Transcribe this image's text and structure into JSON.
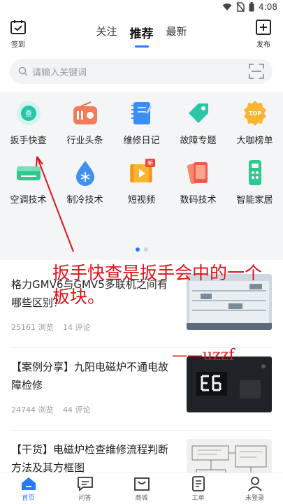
{
  "status_bar": {
    "time": "4:08"
  },
  "header": {
    "checkin_label": "签到",
    "post_label": "发布",
    "tabs": [
      {
        "label": "关注"
      },
      {
        "label": "推荐"
      },
      {
        "label": "最新"
      }
    ],
    "active_tab": "推荐"
  },
  "search": {
    "placeholder": "请输入关键词"
  },
  "grid": {
    "items": [
      {
        "label": "扳手快查",
        "icon": "search-query-icon"
      },
      {
        "label": "行业头条",
        "icon": "radio-icon"
      },
      {
        "label": "维修日记",
        "icon": "notebook-icon"
      },
      {
        "label": "故障专题",
        "icon": "tag-icon"
      },
      {
        "label": "大咖榜单",
        "icon": "top-badge-icon"
      },
      {
        "label": "空调技术",
        "icon": "air-conditioner-icon"
      },
      {
        "label": "制冷技术",
        "icon": "snowflake-drop-icon"
      },
      {
        "label": "短视频",
        "icon": "video-icon"
      },
      {
        "label": "数码技术",
        "icon": "phone-icon"
      },
      {
        "label": "智能家居",
        "icon": "remote-control-icon"
      }
    ],
    "top_badge": "TOP",
    "new_badge": "新"
  },
  "feed": [
    {
      "title": "格力GMV6与GMV5多联机之间有哪些区别？",
      "views": "25161 浏览",
      "comments": "14 评论"
    },
    {
      "title": "【案例分享】九阳电磁炉不通电故障检修",
      "views": "24744 浏览",
      "comments": "44 评论"
    },
    {
      "title": "【干货】电磁炉检查维修流程判断方法及其方框图",
      "views": "",
      "comments": ""
    }
  ],
  "annotation": {
    "text": "扳手快查是扳手会中的一个板块。",
    "signature": "——uzzf"
  },
  "tabbar": [
    {
      "label": "首页",
      "icon": "home-icon"
    },
    {
      "label": "问答",
      "icon": "chat-icon"
    },
    {
      "label": "商城",
      "icon": "shop-icon"
    },
    {
      "label": "工单",
      "icon": "ticket-icon"
    },
    {
      "label": "未登录",
      "icon": "user-icon"
    }
  ],
  "colors": {
    "accent": "#2979ff",
    "annotation": "#e0121b",
    "grid_bg": "#f4f5f7"
  }
}
